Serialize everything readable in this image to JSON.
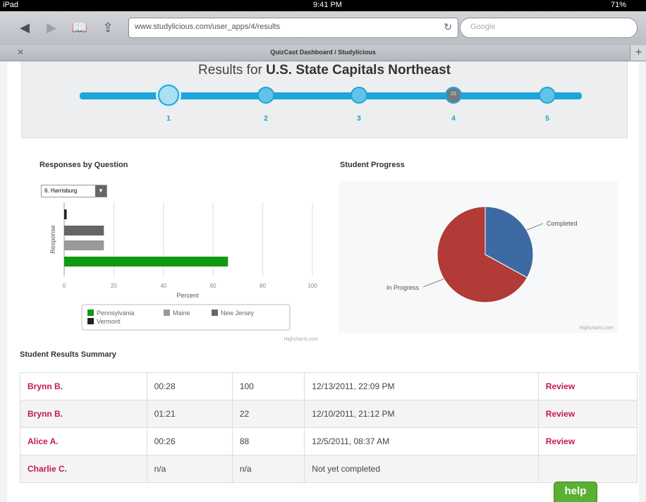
{
  "status_bar": {
    "carrier": "iPad",
    "time": "9:41 PM",
    "battery": "71%"
  },
  "browser": {
    "url": "www.studylicious.com/user_apps/4/results",
    "search_placeholder": "Google",
    "tab_title": "QuizCast Dashboard / Studylicious"
  },
  "header": {
    "title_prefix": "Results for ",
    "title_bold": "U.S. State Capitals Northeast",
    "steps": [
      {
        "label": "1",
        "node_text": ""
      },
      {
        "label": "2",
        "node_text": ""
      },
      {
        "label": "3",
        "node_text": ""
      },
      {
        "label": "4",
        "node_text": "22"
      },
      {
        "label": "5",
        "node_text": ""
      }
    ]
  },
  "responses": {
    "title": "Responses by Question",
    "selected_question": "6. Harrisburg"
  },
  "chart_data": [
    {
      "type": "bar",
      "title": "Responses by Question",
      "xlabel": "Percent",
      "ylabel": "Response",
      "xlim": [
        0,
        100
      ],
      "ticks": [
        "0",
        "20",
        "40",
        "60",
        "80",
        "100"
      ],
      "credit": "Highcharts.com",
      "series": [
        {
          "name": "Vermont",
          "value": 1,
          "color": "#222222"
        },
        {
          "name": "New Jersey",
          "value": 16,
          "color": "#666666"
        },
        {
          "name": "Maine",
          "value": 16,
          "color": "#999999"
        },
        {
          "name": "Pennsylvania",
          "value": 66,
          "color": "#119911"
        }
      ]
    },
    {
      "type": "pie",
      "title": "Student Progress",
      "credit": "Highcharts.com",
      "slices": [
        {
          "label": "Completed",
          "value": 33,
          "color": "#3e6aa3"
        },
        {
          "label": "In Progress",
          "value": 67,
          "color": "#b23a37"
        }
      ]
    }
  ],
  "summary": {
    "title": "Student Results Summary",
    "rows": [
      {
        "name": "Brynn B.",
        "time": "00:28",
        "score": "100",
        "date": "12/13/2011, 22:09 PM",
        "action": "Review"
      },
      {
        "name": "Brynn B.",
        "time": "01:21",
        "score": "22",
        "date": "12/10/2011, 21:12 PM",
        "action": "Review"
      },
      {
        "name": "Alice A.",
        "time": "00:26",
        "score": "88",
        "date": "12/5/2011, 08:37 AM",
        "action": "Review"
      },
      {
        "name": "Charlie C.",
        "time": "n/a",
        "score": "n/a",
        "date": "Not yet completed",
        "action": ""
      }
    ]
  },
  "help_label": "help"
}
